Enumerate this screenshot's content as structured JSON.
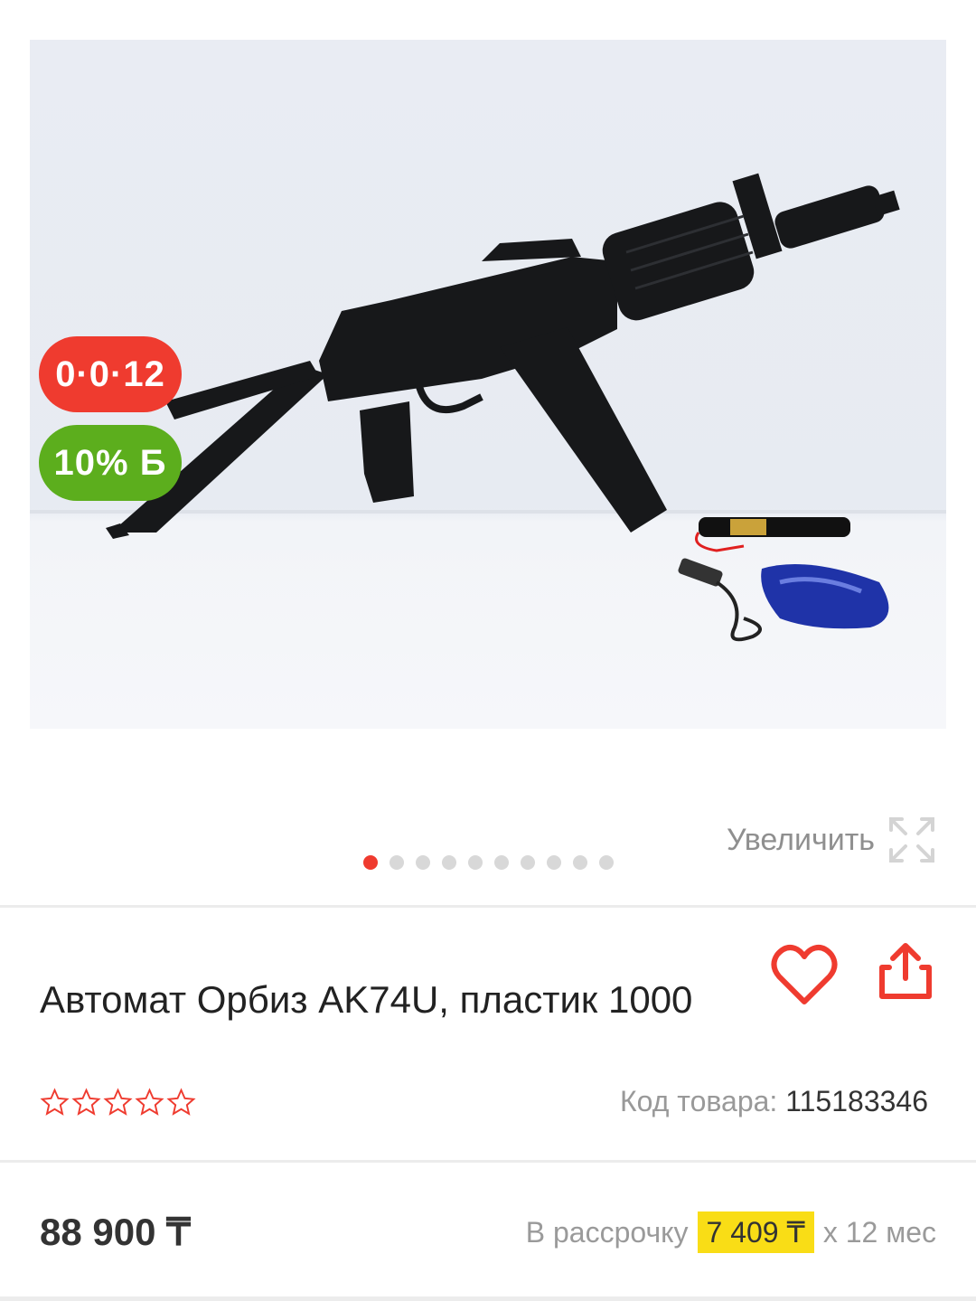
{
  "badges": {
    "timer": "0·0·12",
    "bonus": "10% Б"
  },
  "gallery": {
    "zoom_label": "Увеличить",
    "dots_count": 10,
    "active_dot": 0
  },
  "product": {
    "title": "Автомат Орбиз AK74U, пластик 1000",
    "rating_stars": 5,
    "rating_value": 0,
    "code_label": "Код товара:",
    "code_value": "115183346"
  },
  "price": {
    "value": "88 900 ₸",
    "installment_label": "В рассрочку",
    "installment_amount": "7 409 ₸",
    "installment_term": "х 12 мес"
  },
  "colors": {
    "accent": "#ef3b2f",
    "bonus": "#5cae1d",
    "highlight": "#f9dd16"
  }
}
